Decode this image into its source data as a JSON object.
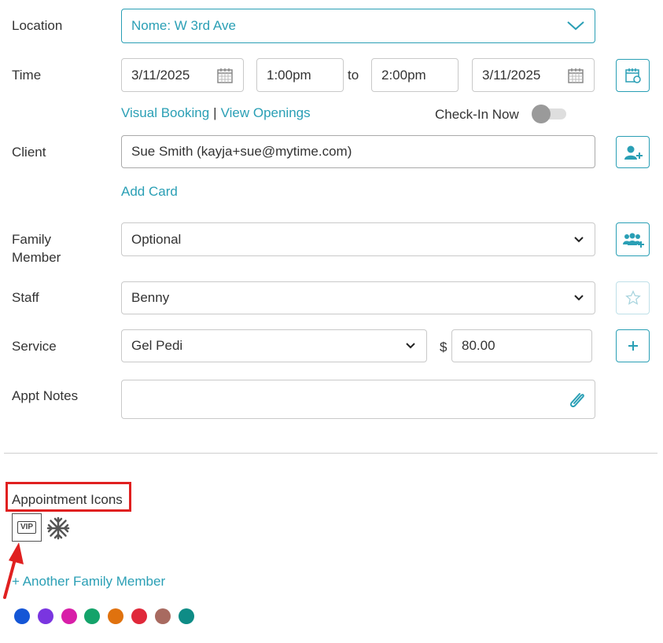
{
  "form": {
    "location": {
      "label": "Location",
      "value": "Nome: W 3rd Ave"
    },
    "time": {
      "label": "Time",
      "start_date": "3/11/2025",
      "start_time": "1:00pm",
      "to_label": "to",
      "end_time": "2:00pm",
      "end_date": "3/11/2025"
    },
    "links": {
      "visual_booking": "Visual Booking",
      "separator": "|",
      "view_openings": "View Openings",
      "check_in_label": "Check-In Now"
    },
    "client": {
      "label": "Client",
      "value": "Sue Smith (kayja+sue@mytime.com)",
      "add_card": "Add Card"
    },
    "family_member": {
      "label_line1": "Family",
      "label_line2": "Member",
      "value": "Optional"
    },
    "staff": {
      "label": "Staff",
      "value": "Benny"
    },
    "service": {
      "label": "Service",
      "value": "Gel Pedi",
      "currency": "$",
      "price": "80.00"
    },
    "notes": {
      "label": "Appt Notes",
      "value": ""
    }
  },
  "appointment_icons": {
    "title": "Appointment Icons",
    "vip_text": "VIP"
  },
  "another_family_member": "+ Another Family Member",
  "colors": {
    "accent": "#2a9fb5",
    "highlight": "#e02020",
    "swatches": [
      "#1456d6",
      "#7a35e0",
      "#d81ea8",
      "#14a36a",
      "#e0720e",
      "#e0283a",
      "#a86a60",
      "#0e8c86"
    ]
  }
}
